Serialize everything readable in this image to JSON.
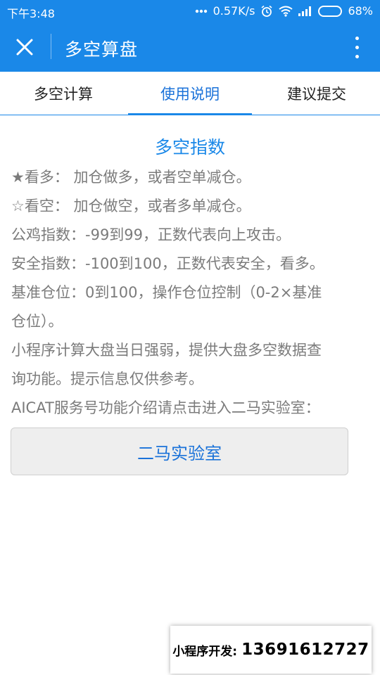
{
  "status_bar": {
    "time": "下午3:48",
    "network_speed": "0.57K/s",
    "battery_percent": "68%",
    "battery_level": 0.68,
    "icons": [
      "more-dots-icon",
      "alarm-icon",
      "wifi-icon",
      "signal-icon",
      "battery-icon"
    ]
  },
  "header": {
    "title": "多空算盘",
    "close_icon": "close-icon",
    "more_icon": "more-vertical-icon",
    "accent_color": "#1a88e8"
  },
  "tabs": [
    {
      "label": "多空计算",
      "active": false
    },
    {
      "label": "使用说明",
      "active": true
    },
    {
      "label": "建议提交",
      "active": false
    }
  ],
  "content": {
    "section_title": "多空指数",
    "lines": [
      "★看多： 加仓做多，或者空单减仓。",
      "☆看空： 加仓做空，或者多单减仓。",
      "公鸡指数：-99到99，正数代表向上攻击。",
      "安全指数：-100到100，正数代表安全，看多。",
      "基准仓位：0到100，操作仓位控制（0-2×基准",
      "仓位）。",
      "小程序计算大盘当日强弱，提供大盘多空数据查",
      "询功能。提示信息仅供参考。",
      "AICAT服务号功能介绍请点击进入二马实验室："
    ],
    "lab_button_label": "二马实验室"
  },
  "footer_badge": {
    "label": "小程序开发:",
    "phone": "13691612727"
  }
}
